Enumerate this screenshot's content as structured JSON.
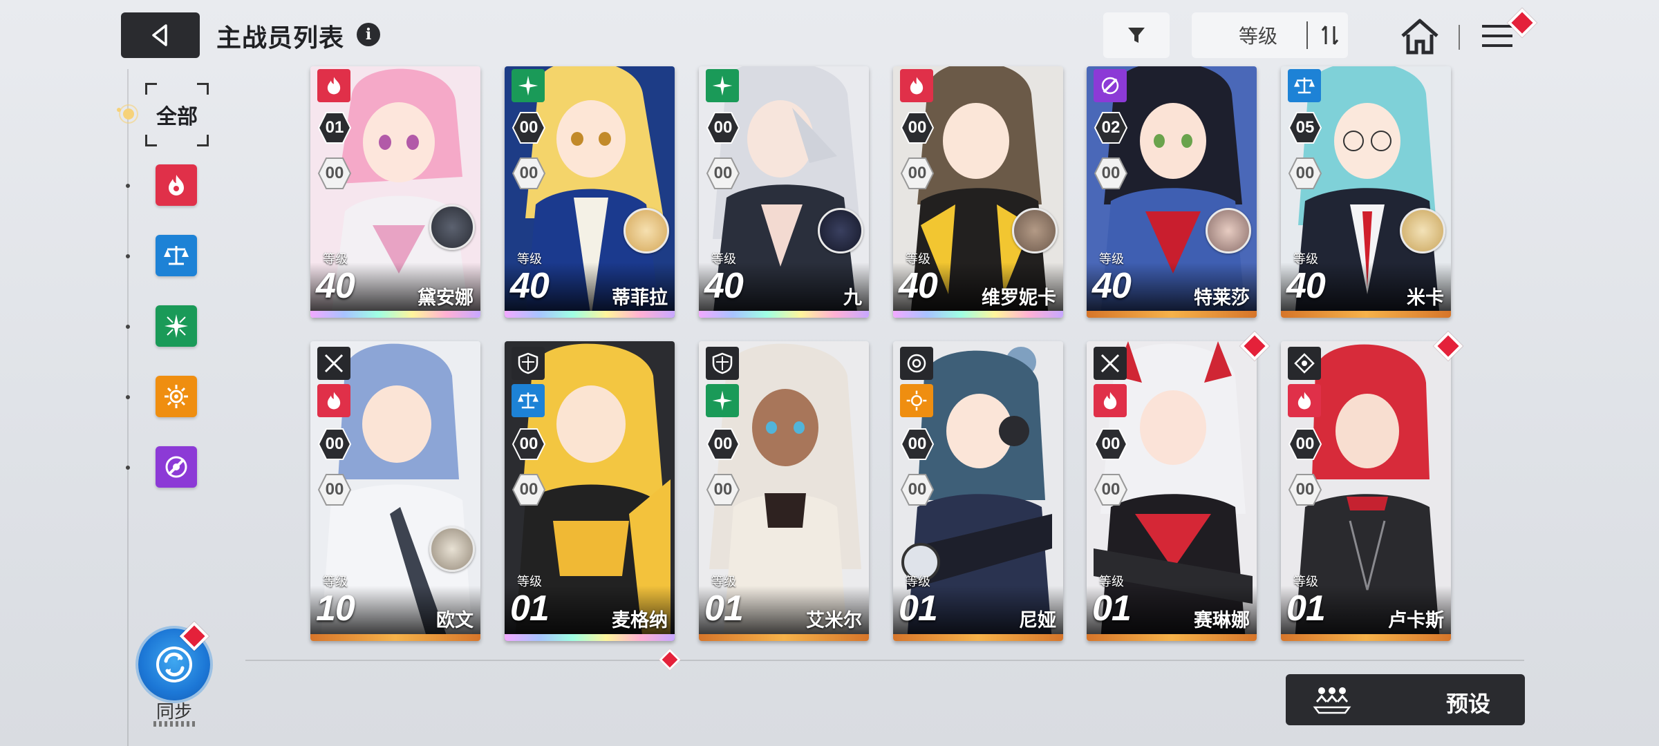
{
  "header": {
    "title": "主战员列表",
    "info_glyph": "i",
    "sort_label": "等级"
  },
  "sidebar": {
    "all_label": "全部",
    "filters": [
      {
        "name": "fire",
        "color": "#e03049"
      },
      {
        "name": "order",
        "color": "#1d82d6"
      },
      {
        "name": "star",
        "color": "#1a9a58"
      },
      {
        "name": "sun",
        "color": "#ef8e10"
      },
      {
        "name": "void",
        "color": "#8c3ad6"
      }
    ],
    "sync_label": "同步"
  },
  "cards": [
    {
      "name": "黛安娜",
      "level_label": "等级",
      "level": "40",
      "rank": "01",
      "sub_rank": "00",
      "attribute": "fire",
      "rainbow": true
    },
    {
      "name": "蒂菲拉",
      "level_label": "等级",
      "level": "40",
      "rank": "00",
      "sub_rank": "00",
      "attribute": "star",
      "rainbow": true
    },
    {
      "name": "九",
      "level_label": "等级",
      "level": "40",
      "rank": "00",
      "sub_rank": "00",
      "attribute": "star",
      "rainbow": true
    },
    {
      "name": "维罗妮卡",
      "level_label": "等级",
      "level": "40",
      "rank": "00",
      "sub_rank": "00",
      "attribute": "fire",
      "rainbow": true
    },
    {
      "name": "特莱莎",
      "level_label": "等级",
      "level": "40",
      "rank": "02",
      "sub_rank": "00",
      "attribute": "void",
      "rainbow": false
    },
    {
      "name": "米卡",
      "level_label": "等级",
      "level": "40",
      "rank": "05",
      "sub_rank": "00",
      "attribute": "order",
      "rainbow": false
    },
    {
      "name": "欧文",
      "level_label": "等级",
      "level": "10",
      "rank": "00",
      "sub_rank": "00",
      "attribute": "fire",
      "class": "sword",
      "rainbow": false
    },
    {
      "name": "麦格纳",
      "level_label": "等级",
      "level": "01",
      "rank": "00",
      "sub_rank": "00",
      "attribute": "order",
      "class": "shield",
      "rainbow": true
    },
    {
      "name": "艾米尔",
      "level_label": "等级",
      "level": "01",
      "rank": "00",
      "sub_rank": "00",
      "attribute": "star",
      "class": "shield",
      "rainbow": false
    },
    {
      "name": "尼娅",
      "level_label": "等级",
      "level": "01",
      "rank": "00",
      "sub_rank": "00",
      "attribute": "sun",
      "class": "target",
      "rainbow": false
    },
    {
      "name": "赛琳娜",
      "level_label": "等级",
      "level": "01",
      "rank": "00",
      "sub_rank": "00",
      "attribute": "fire",
      "class": "sword",
      "rainbow": false
    },
    {
      "name": "卢卡斯",
      "level_label": "等级",
      "level": "01",
      "rank": "00",
      "sub_rank": "00",
      "attribute": "fire",
      "class": "crosshair",
      "rainbow": false
    }
  ],
  "footer": {
    "preset_label": "预设"
  }
}
